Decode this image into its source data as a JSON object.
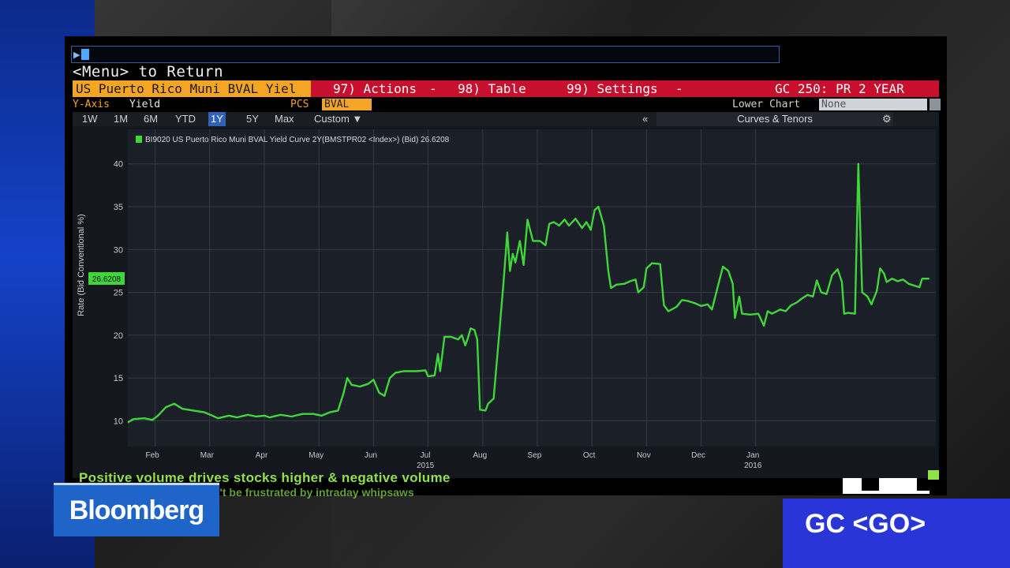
{
  "terminal": {
    "menu_return": "<Menu> to Return",
    "security_name": "US Puerto Rico Muni BVAL Yiel",
    "actions_label": "97) Actions",
    "table_label": "98) Table",
    "settings_label": "99) Settings",
    "dash": "-",
    "function_title": "GC 250: PR 2 YEAR",
    "yaxis_label": "Y-Axis",
    "yaxis_value": "Yield",
    "pcs_label": "PCS",
    "pcs_value": "BVAL",
    "lower_chart_label": "Lower Chart",
    "lower_chart_value": "None",
    "time_buttons": [
      "1W",
      "1M",
      "6M",
      "YTD",
      "1Y",
      "5Y",
      "Max",
      "Custom ▼"
    ],
    "active_time": "1Y",
    "collapse_glyph": "«",
    "curves_tenors": "Curves & Tenors",
    "gear_glyph": "⚙"
  },
  "chart_data": {
    "type": "line",
    "legend": "BI9020 US Puerto Rico Muni BVAL Yield Curve 2Y(BMSTPR02 <Index>) (Bid) 26.6208",
    "ylabel": "Rate (Bid Conventional %)",
    "ylim": [
      7,
      42
    ],
    "yticks": [
      10,
      15,
      20,
      25,
      30,
      35,
      40
    ],
    "last_value_label": "26.6208",
    "last_value": 26.6208,
    "x_month_labels": [
      "Feb",
      "Mar",
      "Apr",
      "May",
      "Jun",
      "Jul",
      "Aug",
      "Sep",
      "Oct",
      "Nov",
      "Dec",
      "Jan"
    ],
    "x_year_labels": [
      "2015",
      "2016"
    ],
    "x_year_under": [
      "Jul",
      "Jan"
    ],
    "line_color": "#3fd63a",
    "series": [
      {
        "values": [
          [
            0,
            9.8
          ],
          [
            0.1,
            10.2
          ],
          [
            0.3,
            10.3
          ],
          [
            0.45,
            10.1
          ],
          [
            0.55,
            10.6
          ],
          [
            0.7,
            11.6
          ],
          [
            0.85,
            12.0
          ],
          [
            1.0,
            11.4
          ],
          [
            1.2,
            11.2
          ],
          [
            1.4,
            11.0
          ],
          [
            1.55,
            10.6
          ],
          [
            1.65,
            10.3
          ],
          [
            1.85,
            10.6
          ],
          [
            2.0,
            10.4
          ],
          [
            2.2,
            10.7
          ],
          [
            2.35,
            10.5
          ],
          [
            2.5,
            10.6
          ],
          [
            2.6,
            10.4
          ],
          [
            2.8,
            10.7
          ],
          [
            3.0,
            10.5
          ],
          [
            3.2,
            10.8
          ],
          [
            3.4,
            10.8
          ],
          [
            3.55,
            10.6
          ],
          [
            3.7,
            11.0
          ],
          [
            3.85,
            11.2
          ],
          [
            3.95,
            13.2
          ],
          [
            4.02,
            15.0
          ],
          [
            4.1,
            14.2
          ],
          [
            4.25,
            14.0
          ],
          [
            4.4,
            14.3
          ],
          [
            4.5,
            14.8
          ],
          [
            4.6,
            13.3
          ],
          [
            4.7,
            12.9
          ],
          [
            4.8,
            15.0
          ],
          [
            4.9,
            15.6
          ],
          [
            5.05,
            15.8
          ],
          [
            5.3,
            15.8
          ],
          [
            5.45,
            15.9
          ],
          [
            5.5,
            15.2
          ],
          [
            5.62,
            15.3
          ],
          [
            5.68,
            17.8
          ],
          [
            5.72,
            15.8
          ],
          [
            5.8,
            19.8
          ],
          [
            5.92,
            19.8
          ],
          [
            6.05,
            19.5
          ],
          [
            6.12,
            20.0
          ],
          [
            6.18,
            18.8
          ],
          [
            6.22,
            19.5
          ],
          [
            6.28,
            20.8
          ],
          [
            6.35,
            20.6
          ],
          [
            6.4,
            19.5
          ],
          [
            6.45,
            11.3
          ],
          [
            6.55,
            11.2
          ],
          [
            6.6,
            12.0
          ],
          [
            6.7,
            12.6
          ],
          [
            6.8,
            20.0
          ],
          [
            6.88,
            26.0
          ],
          [
            6.95,
            32.0
          ],
          [
            7.0,
            27.5
          ],
          [
            7.05,
            29.5
          ],
          [
            7.1,
            28.5
          ],
          [
            7.18,
            31.0
          ],
          [
            7.25,
            28.2
          ],
          [
            7.32,
            33.5
          ],
          [
            7.42,
            31.0
          ],
          [
            7.55,
            31.0
          ],
          [
            7.65,
            30.5
          ],
          [
            7.72,
            33.0
          ],
          [
            7.8,
            33.2
          ],
          [
            7.9,
            32.8
          ],
          [
            8.0,
            33.5
          ],
          [
            8.08,
            32.8
          ],
          [
            8.2,
            33.6
          ],
          [
            8.32,
            32.5
          ],
          [
            8.4,
            33.2
          ],
          [
            8.48,
            32.3
          ],
          [
            8.55,
            34.6
          ],
          [
            8.62,
            35.0
          ],
          [
            8.72,
            32.8
          ],
          [
            8.8,
            27.5
          ],
          [
            8.85,
            25.5
          ],
          [
            8.95,
            25.9
          ],
          [
            9.1,
            26.0
          ],
          [
            9.2,
            26.3
          ],
          [
            9.3,
            26.5
          ],
          [
            9.35,
            25.0
          ],
          [
            9.45,
            25.6
          ],
          [
            9.5,
            27.8
          ],
          [
            9.6,
            28.4
          ],
          [
            9.75,
            28.3
          ],
          [
            9.82,
            23.5
          ],
          [
            9.9,
            22.8
          ],
          [
            10.05,
            23.3
          ],
          [
            10.15,
            24.1
          ],
          [
            10.25,
            24.0
          ],
          [
            10.4,
            23.7
          ],
          [
            10.5,
            23.4
          ],
          [
            10.62,
            23.6
          ],
          [
            10.7,
            23.0
          ],
          [
            10.8,
            25.5
          ],
          [
            10.9,
            28.0
          ],
          [
            11.0,
            27.5
          ],
          [
            11.08,
            26.0
          ],
          [
            11.12,
            22.0
          ],
          [
            11.2,
            24.5
          ],
          [
            11.25,
            22.5
          ],
          [
            11.4,
            22.4
          ],
          [
            11.55,
            22.5
          ],
          [
            11.65,
            21.1
          ],
          [
            11.72,
            22.8
          ],
          [
            11.8,
            22.5
          ],
          [
            11.95,
            23.0
          ],
          [
            12.05,
            22.8
          ],
          [
            12.15,
            23.5
          ],
          [
            12.25,
            23.8
          ],
          [
            12.35,
            24.3
          ],
          [
            12.45,
            24.7
          ],
          [
            12.55,
            24.5
          ],
          [
            12.62,
            26.4
          ],
          [
            12.7,
            25.0
          ],
          [
            12.8,
            24.8
          ],
          [
            12.9,
            27.0
          ],
          [
            13.0,
            27.7
          ],
          [
            13.08,
            26.2
          ],
          [
            13.12,
            22.5
          ],
          [
            13.2,
            22.6
          ],
          [
            13.32,
            22.5
          ],
          [
            13.38,
            40.0
          ],
          [
            13.45,
            25.0
          ],
          [
            13.55,
            24.5
          ],
          [
            13.62,
            23.6
          ],
          [
            13.72,
            25.2
          ],
          [
            13.78,
            27.8
          ],
          [
            13.85,
            27.2
          ],
          [
            13.9,
            26.2
          ],
          [
            14.0,
            26.6
          ],
          [
            14.1,
            26.3
          ],
          [
            14.2,
            26.5
          ],
          [
            14.3,
            26.0
          ],
          [
            14.4,
            25.8
          ],
          [
            14.5,
            25.6
          ],
          [
            14.55,
            26.6
          ],
          [
            14.68,
            26.6
          ]
        ]
      }
    ]
  },
  "overlay": {
    "ticker_line1": "Positive volume drives stocks higher & negative volume",
    "ticker_line2": "n't be frustrated by intraday whipsaws",
    "brand": "Bloomberg",
    "go_label": "GC <GO>"
  }
}
